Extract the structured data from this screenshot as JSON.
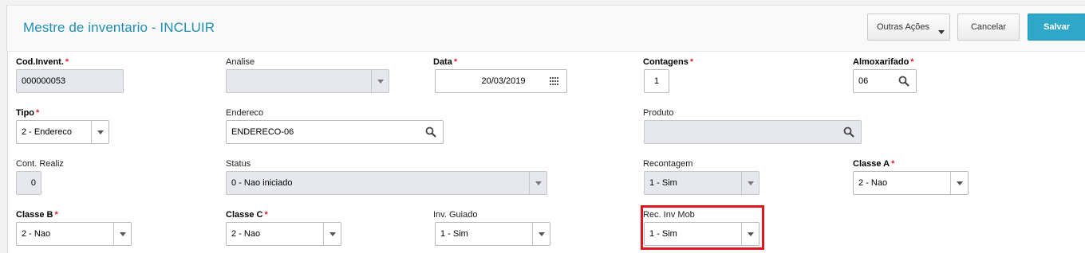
{
  "header": {
    "title": "Mestre de inventario - INCLUIR",
    "more_actions_label": "Outras Ações",
    "cancel_label": "Cancelar",
    "save_label": "Salvar"
  },
  "colors": {
    "accent": "#2ea7c9",
    "title": "#1f8fb5",
    "required": "#d9232d",
    "highlight": "#e0161f"
  },
  "fields": {
    "cod_invent": {
      "label": "Cod.Invent.",
      "required": true,
      "value": "000000053"
    },
    "analise": {
      "label": "Analise",
      "value": ""
    },
    "data": {
      "label": "Data",
      "required": true,
      "value": "20/03/2019"
    },
    "contagens": {
      "label": "Contagens",
      "required": true,
      "value": "1"
    },
    "almoxarifado": {
      "label": "Almoxarifado",
      "required": true,
      "value": "06"
    },
    "tipo": {
      "label": "Tipo",
      "required": true,
      "value": "2 - Endereco"
    },
    "endereco": {
      "label": "Endereco",
      "value": "ENDERECO-06"
    },
    "produto": {
      "label": "Produto",
      "value": ""
    },
    "cont_realiz": {
      "label": "Cont. Realiz",
      "value": "0"
    },
    "status": {
      "label": "Status",
      "value": "0 - Nao iniciado"
    },
    "recontagem": {
      "label": "Recontagem",
      "value": "1 - Sim"
    },
    "classe_a": {
      "label": "Classe A",
      "required": true,
      "value": "2 - Nao"
    },
    "classe_b": {
      "label": "Classe B",
      "required": true,
      "value": "2 - Nao"
    },
    "classe_c": {
      "label": "Classe C",
      "required": true,
      "value": "2 - Nao"
    },
    "inv_guiado": {
      "label": "Inv. Guiado",
      "value": "1 - Sim"
    },
    "rec_inv_mob": {
      "label": "Rec. Inv Mob",
      "value": "1 - Sim"
    }
  },
  "req_mark": "*"
}
